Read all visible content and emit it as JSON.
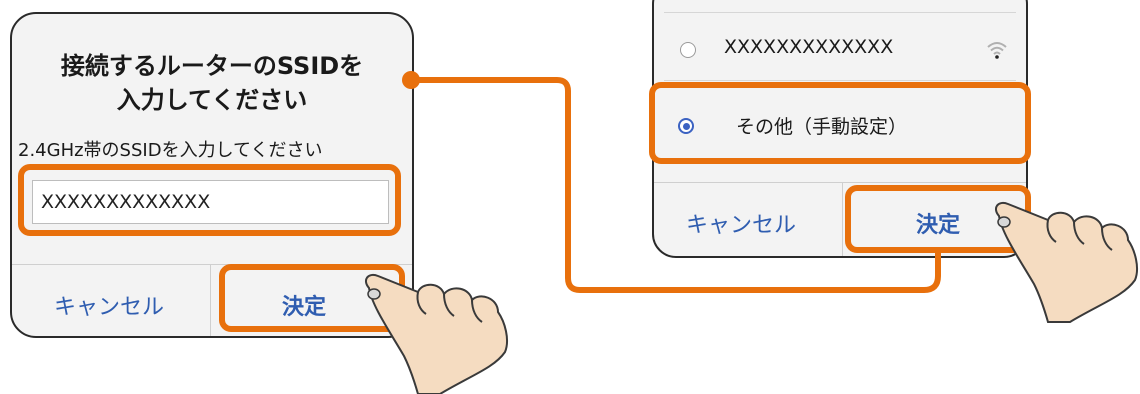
{
  "left_dialog": {
    "title_line1": "接続するルーターのSSIDを",
    "title_line2": "入力してください",
    "subtitle": "2.4GHz帯のSSIDを入力してください",
    "ssid_value": "XXXXXXXXXXXXX",
    "cancel_label": "キャンセル",
    "ok_label": "決定"
  },
  "right_dialog": {
    "network_name": "XXXXXXXXXXXXX",
    "other_option": "その他（手動設定）",
    "cancel_label": "キャンセル",
    "ok_label": "決定"
  },
  "colors": {
    "highlight": "#e8700c",
    "accent": "#2f5db0",
    "hand": "#f5dcc1"
  }
}
